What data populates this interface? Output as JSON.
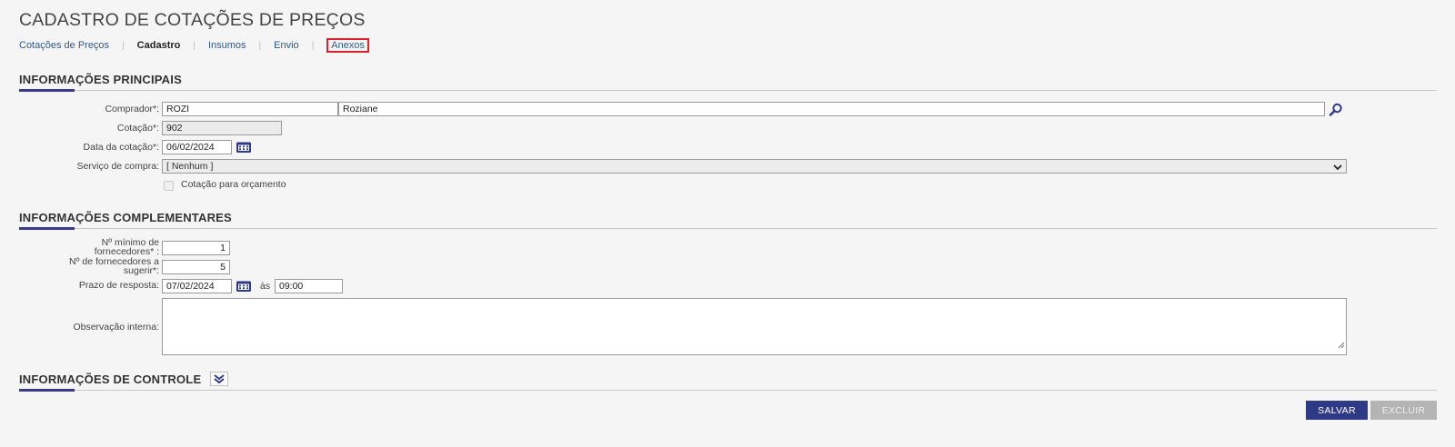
{
  "page": {
    "title": "CADASTRO DE COTAÇÕES DE PREÇOS"
  },
  "breadcrumb": [
    {
      "label": "Cotações de Preços"
    },
    {
      "label": "Cadastro"
    },
    {
      "label": "Insumos"
    },
    {
      "label": "Envio"
    },
    {
      "label": "Anexos"
    }
  ],
  "section_main": {
    "title": "INFORMAÇÕES PRINCIPAIS",
    "comprador_label": "Comprador*:",
    "comprador_code": "ROZI",
    "comprador_name": "Roziane",
    "cotacao_label": "Cotação*:",
    "cotacao_value": "902",
    "data_label": "Data da cotação*:",
    "data_value": "06/02/2024",
    "servico_label": "Serviço de compra:",
    "servico_value": "[ Nenhum ]",
    "orcamento_label": "Cotação para orçamento"
  },
  "section_compl": {
    "title": "INFORMAÇÕES COMPLEMENTARES",
    "min_forn_label": "Nº mínimo de fornecedores* :",
    "min_forn_value": "1",
    "sugerir_label": "Nº de fornecedores a sugerir*:",
    "sugerir_value": "5",
    "prazo_label": "Prazo de resposta:",
    "prazo_date": "07/02/2024",
    "as_label": "às",
    "prazo_time": "09:00",
    "obs_label": "Observação interna:",
    "obs_value": ""
  },
  "section_ctrl": {
    "title": "INFORMAÇÕES DE CONTROLE"
  },
  "actions": {
    "save_label": "SALVAR",
    "delete_label": "EXCLUIR"
  },
  "colors": {
    "accent": "#2e3a85",
    "highlight": "#e0202a",
    "link": "#2f5a8a"
  },
  "icons": {
    "search": "search-icon",
    "calendar": "calendar-icon",
    "dropdown": "chevron-down-icon",
    "expand": "double-chevron-down-icon"
  }
}
